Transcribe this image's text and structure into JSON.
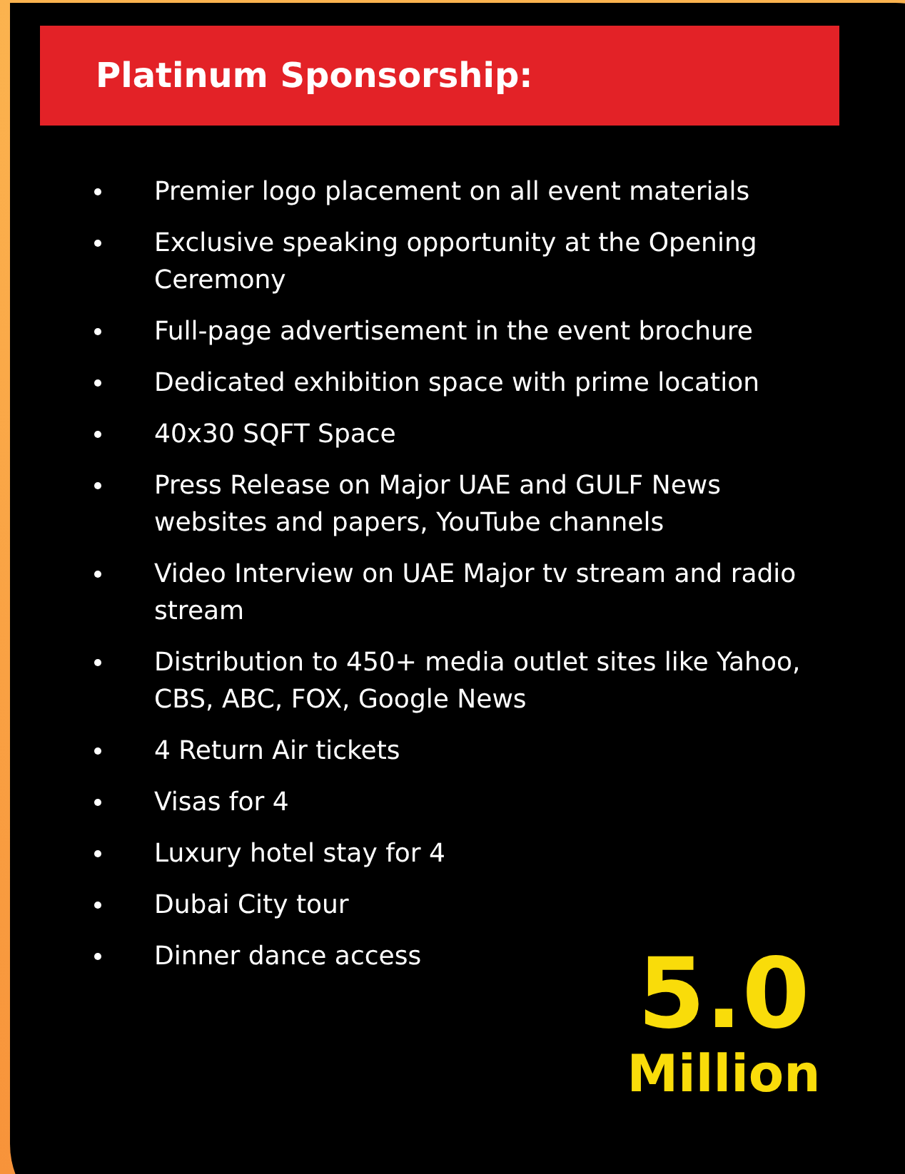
{
  "card": {
    "title": "Platinum Sponsorship:",
    "benefits": [
      "Premier logo placement on all event materials",
      "Exclusive speaking opportunity at the Opening Ceremony",
      "Full-page advertisement in the event brochure",
      "Dedicated exhibition space with prime location",
      "40x30 SQFT Space",
      "Press Release on Major UAE and GULF News websites and papers, YouTube channels",
      "Video Interview on UAE Major tv stream and radio stream",
      "Distribution to 450+ media outlet sites like Yahoo, CBS, ABC, FOX, Google News",
      "4 Return Air tickets",
      "Visas for 4",
      "Luxury hotel stay for 4",
      "Dubai City tour",
      "Dinner dance access"
    ],
    "price": {
      "amount": "5.0",
      "unit": "Million"
    }
  }
}
